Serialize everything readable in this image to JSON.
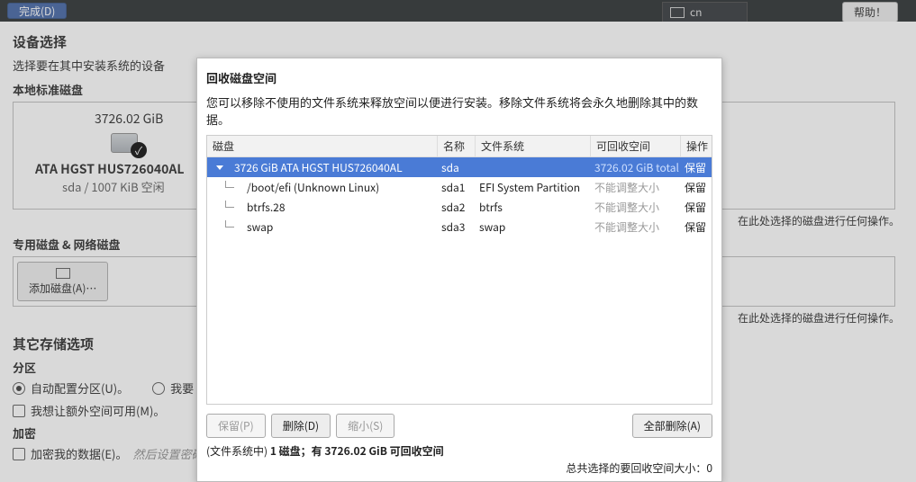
{
  "topbar": {
    "done": "完成(D)",
    "kbd": "cn",
    "help": "帮助！"
  },
  "page": {
    "title": "设备选择",
    "subtitle": "选择要在其中安装系统的设备",
    "local_disks_label": "本地标准磁盘",
    "disk": {
      "capacity": "3726.02 GiB",
      "name": "ATA HGST HUS726040AL",
      "sub": "sda   /   1007 KiB 空闲"
    },
    "right_note": "在此处选择的磁盘进行任何操作。",
    "special_disks_label": "专用磁盘 & 网络磁盘",
    "add_disk": "添加磁盘(A)…",
    "storage_heading": "其它存储选项",
    "partition_label": "分区",
    "opt_auto": "自动配置分区(U)。",
    "opt_iwant": "我要",
    "opt_extra": "我想让额外空间可用(M)。",
    "encrypt_label": "加密",
    "encrypt_opt": "加密我的数据(E)。",
    "encrypt_hint": "然后设置密码"
  },
  "modal": {
    "title": "回收磁盘空间",
    "subtitle": "您可以移除不使用的文件系统来释放空间以便进行安装。移除文件系统将会永久地删除其中的数据。",
    "headers": {
      "disk": "磁盘",
      "name": "名称",
      "fs": "文件系统",
      "reclaim": "可回收空间",
      "action": "操作"
    },
    "rows": [
      {
        "indent": "root",
        "disk": "3726 GiB ATA HGST HUS726040AL",
        "name": "sda",
        "fs": "",
        "reclaim": "3726.02 GiB total",
        "action": "保留",
        "selected": true
      },
      {
        "indent": "child",
        "disk": "/boot/efi (Unknown Linux)",
        "name": "sda1",
        "fs": "EFI System Partition",
        "reclaim": "不能调整大小",
        "action": "保留"
      },
      {
        "indent": "child",
        "disk": "btrfs.28",
        "name": "sda2",
        "fs": "btrfs",
        "reclaim": "不能调整大小",
        "action": "保留"
      },
      {
        "indent": "child",
        "disk": "swap",
        "name": "sda3",
        "fs": "swap",
        "reclaim": "不能调整大小",
        "action": "保留"
      }
    ],
    "buttons": {
      "keep": "保留(P)",
      "delete": "删除(D)",
      "shrink": "缩小(S)",
      "delete_all": "全部删除(A)"
    },
    "status_prefix": "(文件系统中) ",
    "status_bold": "1 磁盘；有 3726.02 GiB 可回收空间",
    "footer_right": "总共选择的要回收空间大小：0"
  }
}
